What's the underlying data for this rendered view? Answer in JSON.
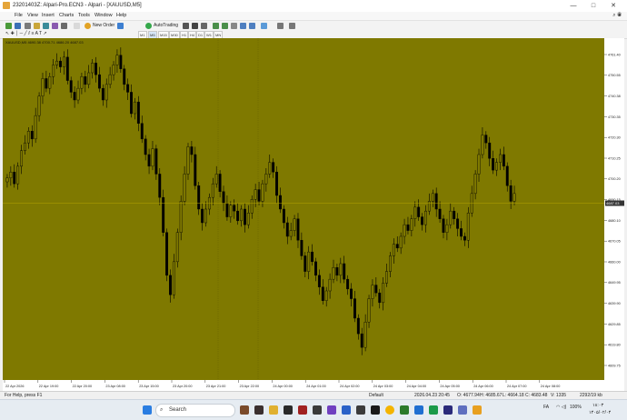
{
  "window": {
    "title": "23201403Z: Alpari-Pro.ECN3 - Alpari - [XAUUSD,M5]",
    "controls": [
      "—",
      "□",
      "✕"
    ]
  },
  "menu": {
    "items": [
      "File",
      "View",
      "Insert",
      "Charts",
      "Tools",
      "Window",
      "Help"
    ]
  },
  "toolbar": {
    "new_order_label": "New Order",
    "autotrading_label": "AutoTrading"
  },
  "timeframes": [
    "M1",
    "M5",
    "M15",
    "M30",
    "H1",
    "H4",
    "D1",
    "W1",
    "MN"
  ],
  "chart": {
    "header": "XAUUSD,M5  4690.38 4700.71 4686.20 4687.03",
    "background": "#7f7900",
    "candle_color": "#000000",
    "bid_line_color": "#b5a300",
    "price_label": "4687.03",
    "price_ticks": [
      "4761.40",
      "4750.55",
      "4740.38",
      "4730.35",
      "4720.30",
      "4710.25",
      "4700.20",
      "4690.15",
      "4680.10",
      "4670.05",
      "4660.00",
      "4649.95",
      "4639.90",
      "4629.85",
      "4619.80",
      "4609.75"
    ],
    "time_ticks": [
      "22 Apr 2026",
      "22 Apr 19:00",
      "22 Apr 20:00",
      "23 Apr 08:00",
      "23 Apr 15:00",
      "23 Apr 20:00",
      "23 Apr 21:00",
      "23 Apr 22:00",
      "24 Apr 00:00",
      "24 Apr 01:00",
      "24 Apr 02:00",
      "24 Apr 03:00",
      "24 Apr 04:00",
      "24 Apr 05:00",
      "24 Apr 06:00",
      "24 Apr 07:00",
      "24 Apr 08:00"
    ]
  },
  "chart_data": {
    "type": "candlestick",
    "symbol": "XAUUSD",
    "timeframe": "M5",
    "ylim": [
      4600,
      4768
    ],
    "close": [
      4700,
      4703,
      4697,
      4706,
      4714,
      4718,
      4724,
      4720,
      4732,
      4742,
      4751,
      4746,
      4752,
      4758,
      4760,
      4757,
      4762,
      4750,
      4744,
      4740,
      4746,
      4752,
      4748,
      4754,
      4759,
      4753,
      4746,
      4740,
      4748,
      4753,
      4758,
      4763,
      4756,
      4748,
      4744,
      4733,
      4739,
      4728,
      4720,
      4712,
      4706,
      4715,
      4702,
      4690,
      4672,
      4650,
      4640,
      4657,
      4672,
      4688,
      4702,
      4716,
      4712,
      4696,
      4684,
      4677,
      4684,
      4690,
      4697,
      4702,
      4693,
      4687,
      4680,
      4686,
      4683,
      4678,
      4684,
      4676,
      4682,
      4689,
      4694,
      4688,
      4697,
      4702,
      4708,
      4703,
      4691,
      4684,
      4677,
      4670,
      4673,
      4679,
      4668,
      4660,
      4652,
      4662,
      4657,
      4650,
      4644,
      4637,
      4642,
      4648,
      4654,
      4650,
      4656,
      4648,
      4643,
      4638,
      4628,
      4620,
      4613,
      4626,
      4638,
      4645,
      4641,
      4636,
      4646,
      4652,
      4660,
      4666,
      4664,
      4670,
      4676,
      4673,
      4679,
      4685,
      4680,
      4676,
      4683,
      4688,
      4692,
      4684,
      4679,
      4672,
      4676,
      4683,
      4679,
      4674,
      4670,
      4668,
      4682,
      4692,
      4702,
      4712,
      4722,
      4718,
      4710,
      4704,
      4708,
      4712,
      4706,
      4696,
      4688,
      4692
    ]
  },
  "status": {
    "help": "For Help, press F1",
    "profile": "Default",
    "datetime": "2026.04.23 20:45",
    "open": "O: 4677.94",
    "high": "H: 4685.67",
    "low": "L: 4664.18",
    "close": "C: 4683.48",
    "volume": "V: 1335",
    "traffic": "2292/19 kb"
  },
  "taskbar": {
    "search_label": "Search",
    "clock_time": "۱۸:۰۳",
    "clock_date": "۱۴۰۵/۰۲/۰۴",
    "lang": "FA",
    "battery": "100%"
  }
}
